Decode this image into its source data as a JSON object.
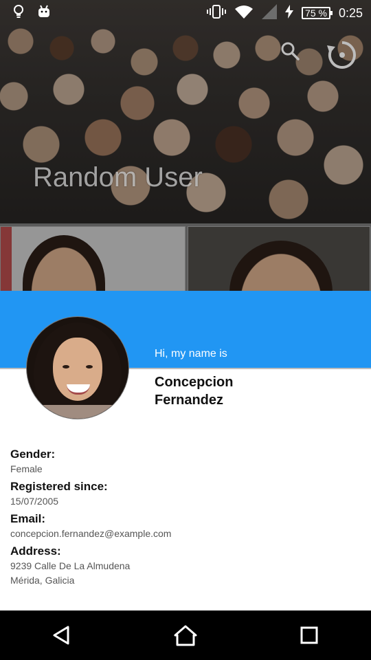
{
  "status_bar": {
    "time": "0:25",
    "battery_percent": "75 %",
    "icons": [
      "lightbulb-icon",
      "android-icon",
      "vibrate-icon",
      "wifi-icon",
      "signal-icon",
      "charging-icon"
    ]
  },
  "header": {
    "title": "Random User",
    "actions": [
      "search-icon",
      "restore-icon"
    ]
  },
  "profile": {
    "greeting": "Hi, my name is",
    "first_name": "Concepcion",
    "last_name": "Fernandez",
    "accent_color": "#2196f3"
  },
  "details": {
    "gender_label": "Gender:",
    "gender_value": "Female",
    "registered_label": "Registered since:",
    "registered_value": "15/07/2005",
    "email_label": "Email:",
    "email_value": "concepcion.fernandez@example.com",
    "address_label": "Address:",
    "address_line1": "9239 Calle De La Almudena",
    "address_line2": "Mérida, Galicia"
  },
  "nav_bar": {
    "buttons": [
      "back-icon",
      "home-icon",
      "recents-icon"
    ]
  }
}
